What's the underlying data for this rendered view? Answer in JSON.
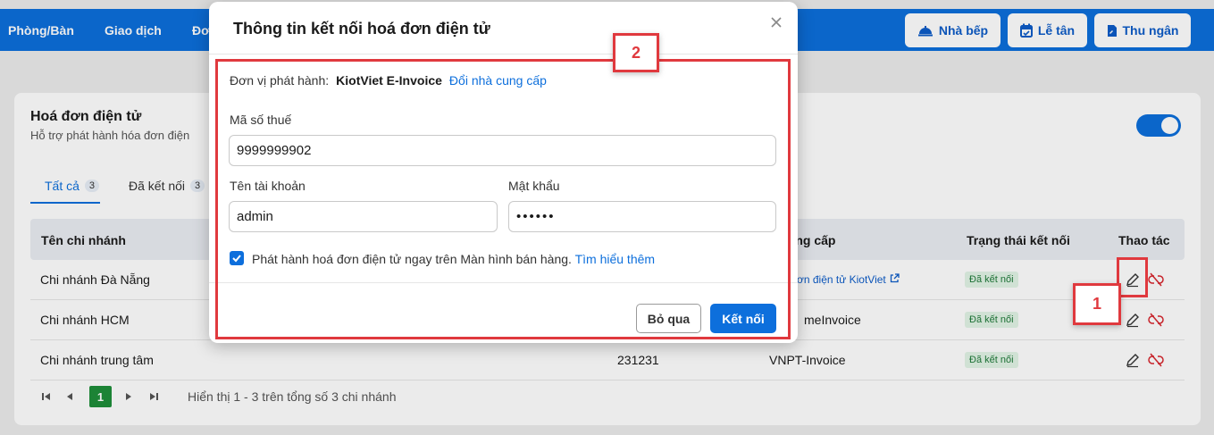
{
  "nav": {
    "items": [
      "Phòng/Bàn",
      "Giao dịch",
      "Đơ"
    ],
    "buttons": [
      {
        "label": "Nhà bếp",
        "icon": "kitchen-bell-icon"
      },
      {
        "label": "Lễ tân",
        "icon": "calendar-check-icon"
      },
      {
        "label": "Thu ngân",
        "icon": "document-icon"
      }
    ]
  },
  "card": {
    "title": "Hoá đơn điện tử",
    "subtitle": "Hỗ trợ phát hành hóa đơn điện",
    "toggle_on": true,
    "tabs": [
      {
        "label": "Tất cả",
        "count": "3"
      },
      {
        "label": "Đã kết nối",
        "count": "3"
      }
    ]
  },
  "table": {
    "headers": [
      "Tên chi nhánh",
      "cung cấp",
      "Trạng thái kết nối",
      "Thao tác"
    ],
    "rows": [
      {
        "branch": "Chi nhánh Đà Nẵng",
        "tax": "",
        "provider": "ơn điện tử KiotViet",
        "status": "Đã kết nối"
      },
      {
        "branch": "Chi nhánh HCM",
        "tax": "",
        "provider": "meInvoice",
        "status": "Đã kết nối"
      },
      {
        "branch": "Chi nhánh trung tâm",
        "tax": "231231",
        "provider": "VNPT-Invoice",
        "status": "Đã kết nối"
      }
    ]
  },
  "pager": {
    "current_page": "1",
    "summary": "Hiển thị 1 - 3 trên tổng số 3 chi nhánh"
  },
  "modal": {
    "title": "Thông tin kết nối hoá đơn điện tử",
    "issuer_label": "Đơn vị phát hành:",
    "issuer_name": "KiotViet E-Invoice",
    "change_provider": "Đổi nhà cung cấp",
    "tax_label": "Mã số thuế",
    "tax_value": "9999999902",
    "account_label": "Tên tài khoản",
    "account_value": "admin",
    "password_label": "Mật khẩu",
    "password_value": "••••••",
    "checkbox_checked": true,
    "checkbox_text": "Phát hành hoá đơn điện tử ngay trên Màn hình bán hàng.",
    "learn_more": "Tìm hiểu thêm",
    "skip_button": "Bỏ qua",
    "connect_button": "Kết nối"
  },
  "annotations": {
    "tag_1": "1",
    "tag_2": "2"
  },
  "colors": {
    "primary": "#0d6fdc",
    "nav_bg": "#0d6fdc",
    "badge_bg": "#e2f5e6",
    "badge_text": "#1f7a3a",
    "annotation": "#e0393e",
    "pager_active": "#1f8f3a"
  }
}
